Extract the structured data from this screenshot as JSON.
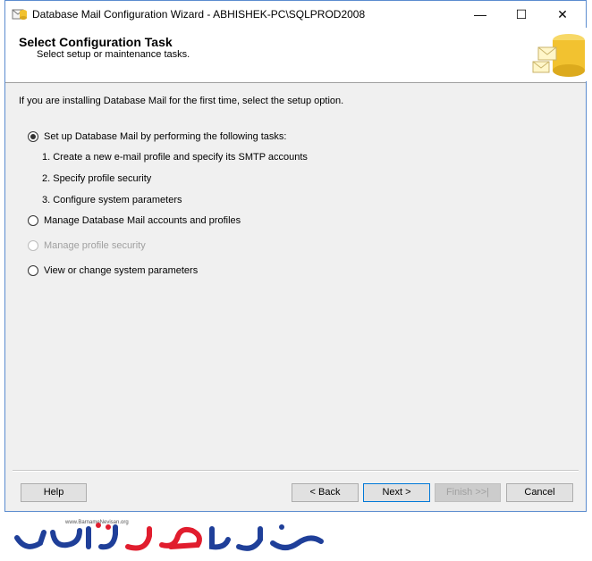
{
  "window": {
    "title": "Database Mail Configuration Wizard - ABHISHEK-PC\\SQLPROD2008",
    "min_glyph": "—",
    "max_glyph": "☐",
    "close_glyph": "✕"
  },
  "header": {
    "title": "Select Configuration Task",
    "subtitle": "Select setup or maintenance tasks."
  },
  "intro": "If you are installing Database Mail for the first time, select the setup option.",
  "options": [
    {
      "label": "Set up Database Mail by performing the following tasks:",
      "checked": true,
      "enabled": true
    },
    {
      "label": "Manage Database Mail accounts and profiles",
      "checked": false,
      "enabled": true
    },
    {
      "label": "Manage profile security",
      "checked": false,
      "enabled": false
    },
    {
      "label": "View or change system parameters",
      "checked": false,
      "enabled": true
    }
  ],
  "steps": [
    "1. Create a new e-mail profile and specify its SMTP accounts",
    "2. Specify profile security",
    "3. Configure system parameters"
  ],
  "buttons": {
    "help": "Help",
    "back": "< Back",
    "next": "Next >",
    "finish": "Finish >>|",
    "cancel": "Cancel"
  },
  "watermark": {
    "url": "www.BarnameNevisan.org",
    "colors": {
      "blue": "#1f3f99",
      "red": "#e11d2e"
    }
  }
}
